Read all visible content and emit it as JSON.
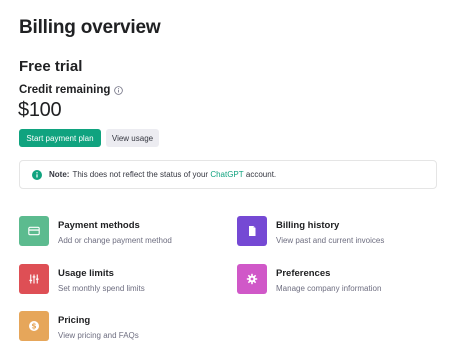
{
  "header": {
    "title": "Billing overview"
  },
  "plan": {
    "name": "Free trial",
    "credit_label": "Credit remaining",
    "credit_amount": "$100"
  },
  "actions": {
    "start_plan_label": "Start payment plan",
    "view_usage_label": "View usage"
  },
  "note": {
    "prefix": "Note:",
    "text_before_link": "This does not reflect the status of your",
    "link_text": "ChatGPT",
    "text_after_link": "account."
  },
  "cards": [
    {
      "title": "Payment methods",
      "subtitle": "Add or change payment method",
      "icon": "credit-card-icon",
      "color": "#5cbb8f"
    },
    {
      "title": "Billing history",
      "subtitle": "View past and current invoices",
      "icon": "document-icon",
      "color": "#7549d4"
    },
    {
      "title": "Usage limits",
      "subtitle": "Set monthly spend limits",
      "icon": "sliders-icon",
      "color": "#de4f55"
    },
    {
      "title": "Preferences",
      "subtitle": "Manage company information",
      "icon": "gear-icon",
      "color": "#d058c8"
    },
    {
      "title": "Pricing",
      "subtitle": "View pricing and FAQs",
      "icon": "dollar-icon",
      "color": "#e6a65a"
    }
  ],
  "colors": {
    "accent": "#10a37f",
    "secondary_button": "#ececf1"
  }
}
